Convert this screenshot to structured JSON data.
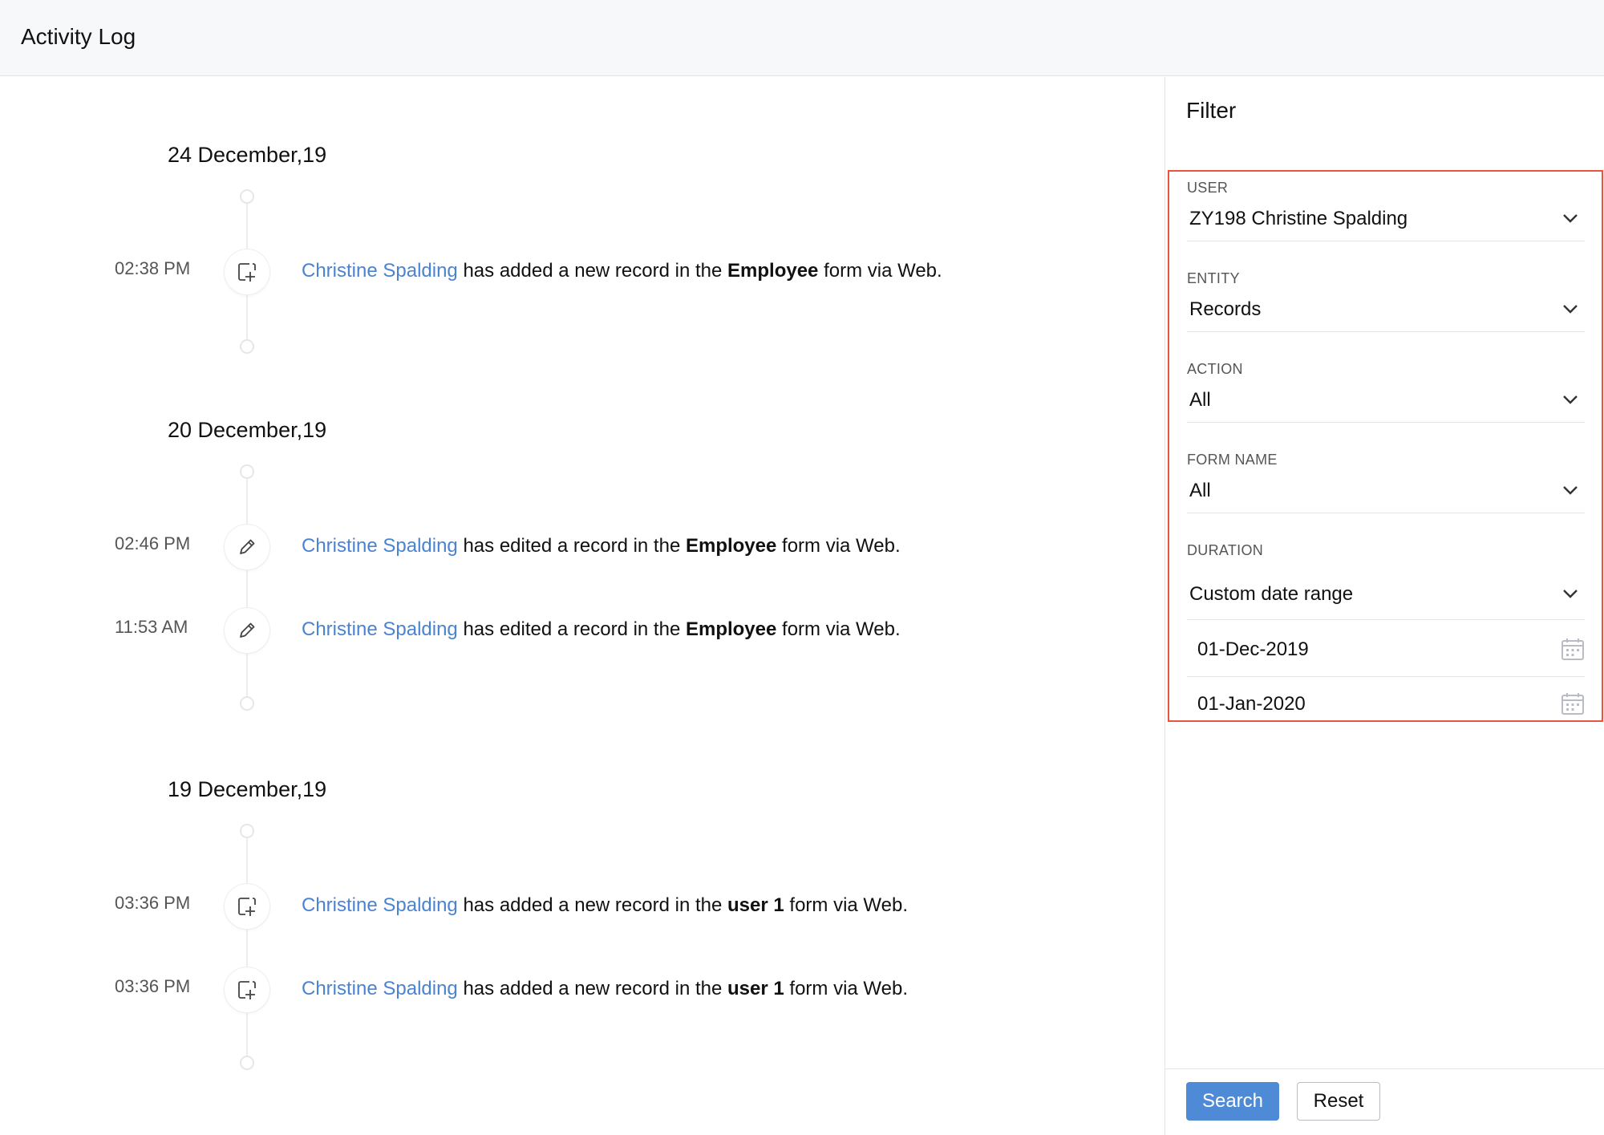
{
  "header": {
    "title": "Activity Log"
  },
  "timeline": {
    "groups": [
      {
        "date": "24 December,19",
        "entries": [
          {
            "time": "02:38 PM",
            "icon": "add-record-icon",
            "user": "Christine Spalding",
            "action": "has added a new record in the",
            "form": "Employee",
            "suffix": "form via Web."
          }
        ]
      },
      {
        "date": "20 December,19",
        "entries": [
          {
            "time": "02:46 PM",
            "icon": "edit-pencil-icon",
            "user": "Christine Spalding",
            "action": "has edited a record in the",
            "form": "Employee",
            "suffix": "form via Web."
          },
          {
            "time": "11:53 AM",
            "icon": "edit-pencil-icon",
            "user": "Christine Spalding",
            "action": "has edited a record in the",
            "form": "Employee",
            "suffix": "form via Web."
          }
        ]
      },
      {
        "date": "19 December,19",
        "entries": [
          {
            "time": "03:36 PM",
            "icon": "add-record-icon",
            "user": "Christine Spalding",
            "action": "has added a new record in the",
            "form": "user 1",
            "suffix": "form via Web."
          },
          {
            "time": "03:36 PM",
            "icon": "add-record-icon",
            "user": "Christine Spalding",
            "action": "has added a new record in the",
            "form": "user 1",
            "suffix": "form via Web."
          }
        ]
      }
    ]
  },
  "filter": {
    "title": "Filter",
    "user": {
      "label": "USER",
      "value": "ZY198 Christine Spalding"
    },
    "entity": {
      "label": "ENTITY",
      "value": "Records"
    },
    "action": {
      "label": "ACTION",
      "value": "All"
    },
    "form_name": {
      "label": "FORM NAME",
      "value": "All"
    },
    "duration": {
      "label": "DURATION",
      "value": "Custom date range"
    },
    "from_date": "01-Dec-2019",
    "to_date": "01-Jan-2020",
    "search_label": "Search",
    "reset_label": "Reset"
  },
  "colors": {
    "link": "#4a83cf",
    "primary_button": "#4f8ad6",
    "highlight_border": "#e8543e"
  }
}
